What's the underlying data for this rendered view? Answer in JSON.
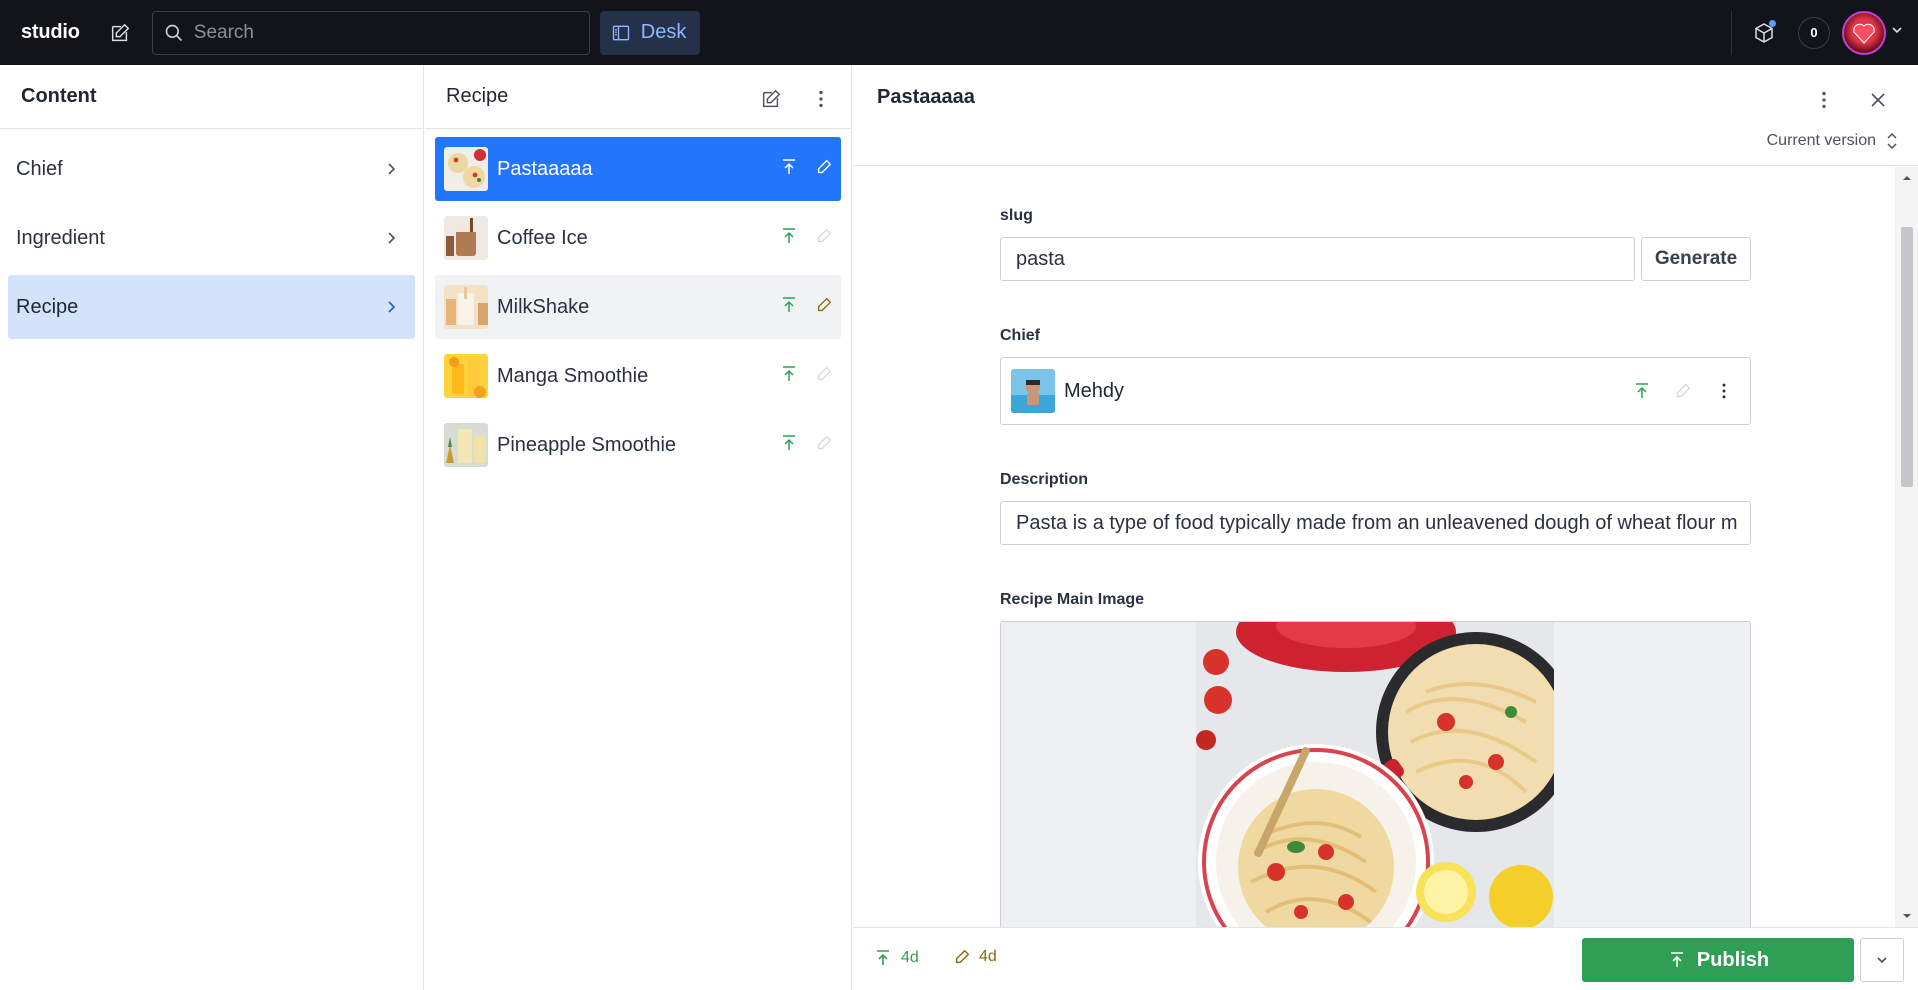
{
  "topbar": {
    "brand": "studio",
    "search_placeholder": "Search",
    "desk_label": "Desk",
    "notification_count": "0"
  },
  "content_pane": {
    "title": "Content",
    "items": [
      {
        "label": "Chief"
      },
      {
        "label": "Ingredient"
      },
      {
        "label": "Recipe"
      }
    ]
  },
  "recipe_pane": {
    "title": "Recipe",
    "documents": [
      {
        "label": "Pastaaaaa"
      },
      {
        "label": "Coffee Ice"
      },
      {
        "label": "MilkShake"
      },
      {
        "label": "Manga Smoothie"
      },
      {
        "label": "Pineapple Smoothie"
      }
    ]
  },
  "editor": {
    "title": "Pastaaaaa",
    "version_label": "Current version",
    "slug": {
      "label": "slug",
      "value": "pasta",
      "generate_label": "Generate"
    },
    "chief": {
      "label": "Chief",
      "value": "Mehdy"
    },
    "description": {
      "label": "Description",
      "value": "Pasta is a type of food typically made from an unleavened dough of wheat flour m"
    },
    "main_image": {
      "label": "Recipe Main Image"
    },
    "footer": {
      "published_ago": "4d",
      "edited_ago": "4d",
      "publish_label": "Publish"
    }
  },
  "colors": {
    "topbar_bg": "#13141a",
    "selected_doc": "#2276fc",
    "active_nav": "#d3e3fb",
    "publish_green": "#2e9f54",
    "published_icon": "#2e9f54",
    "draft_icon": "#8b6a10"
  }
}
